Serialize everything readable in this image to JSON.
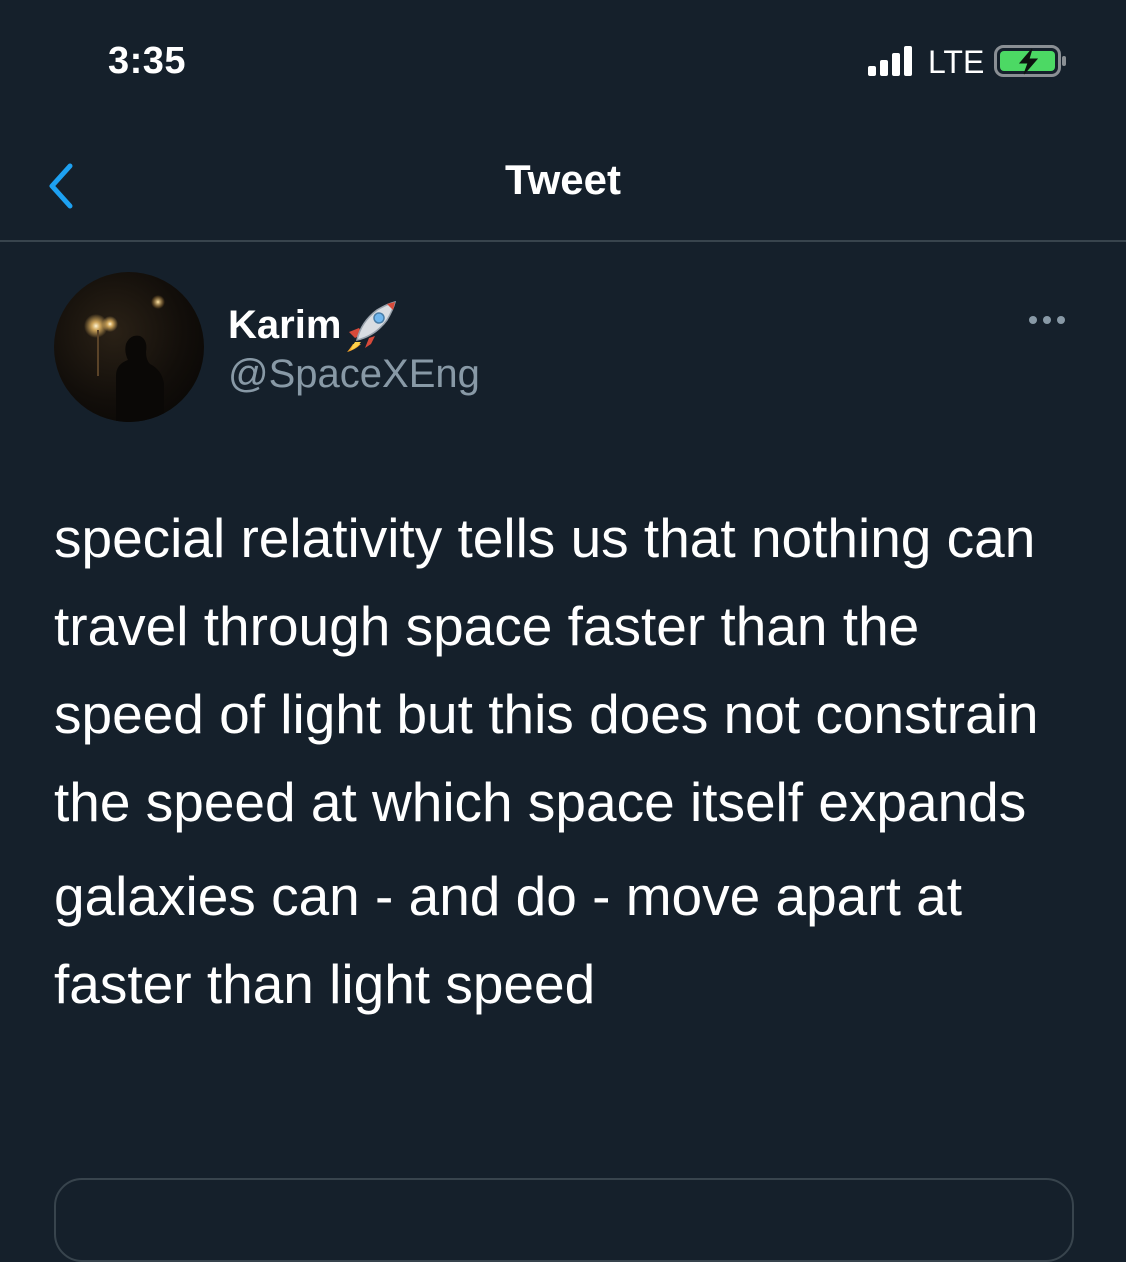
{
  "status_bar": {
    "time": "3:35",
    "network": "LTE",
    "battery_color": "#4cd964"
  },
  "nav": {
    "title": "Tweet",
    "accent_color": "#1da1f2"
  },
  "tweet": {
    "author": {
      "display_name": "Karim",
      "emoji_icon": "rocket-icon",
      "handle": "@SpaceXEng"
    },
    "paragraphs": [
      "special relativity tells us that nothing can travel through space faster than the speed of light but this does not constrain the speed at which space itself expands",
      "galaxies can - and do - move apart at faster than light speed"
    ]
  },
  "colors": {
    "background": "#15202b",
    "secondary_text": "#8899a6",
    "divider": "#38444d"
  }
}
